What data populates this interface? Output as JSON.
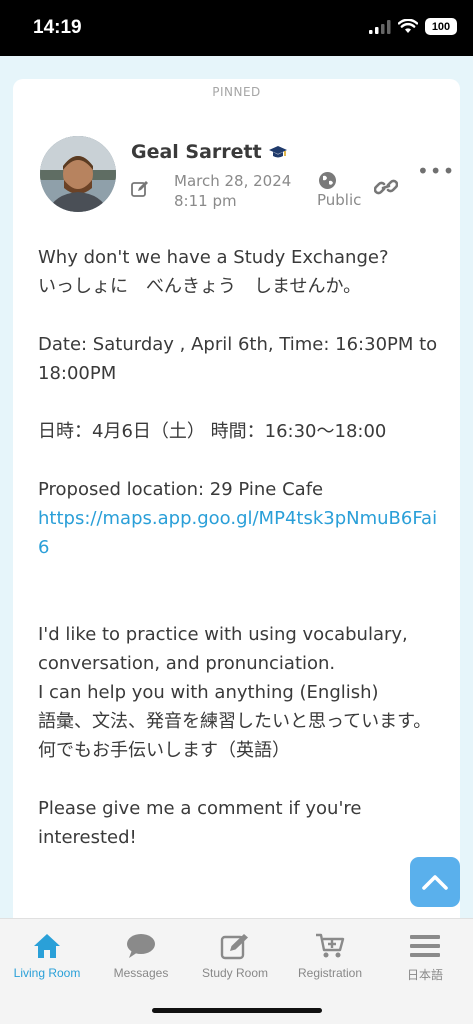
{
  "status_bar": {
    "time": "14:19",
    "battery": "100"
  },
  "post": {
    "pinned_label": "PINNED",
    "author": "Geal Sarrett",
    "date": "March 28, 2024",
    "time": "8:11 pm",
    "visibility": "Public",
    "lines": [
      "Why don't we have a Study Exchange?",
      "いっしょに　べんきょう　しませんか。",
      "Date: Saturday , April 6th, Time: 16:30PM to 18:00PM",
      "日時：4月6日（土） 時間：16:30〜18:00",
      "Proposed location: 29 Pine Cafe",
      "https://maps.app.goo.gl/MP4tsk3pNmuB6Fai6",
      "I'd like to practice with using vocabulary, conversation, and pronunciation.",
      "I can help you with anything (English)",
      "語彙、文法、発音を練習したいと思っています。",
      "何でもお手伝いします（英語）",
      "Please give me a comment if you're interested!"
    ]
  },
  "tabs": [
    {
      "label": "Living Room",
      "icon": "home-icon",
      "active": true
    },
    {
      "label": "Messages",
      "icon": "chat-bubble-icon",
      "active": false
    },
    {
      "label": "Study Room",
      "icon": "edit-note-icon",
      "active": false
    },
    {
      "label": "Registration",
      "icon": "cart-add-icon",
      "active": false
    },
    {
      "label": "日本語",
      "icon": "menu-icon",
      "active": false
    }
  ],
  "colors": {
    "accent": "#2aa0d8",
    "feed_background": "#e6f5fa",
    "link": "#2a9fd8",
    "scroll_button": "#5ab0ec"
  }
}
